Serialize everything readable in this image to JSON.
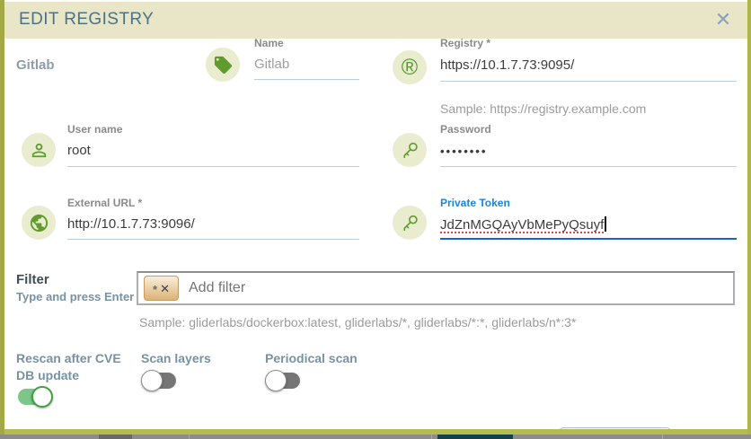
{
  "dialog": {
    "title": "EDIT REGISTRY",
    "close_icon": "✕",
    "registry_display_name": "Gitlab",
    "fields": {
      "name": {
        "label": "Name",
        "placeholder": "Gitlab",
        "value": ""
      },
      "registry": {
        "label": "Registry *",
        "value": "https://10.1.7.73:9095/",
        "hint": "Sample: https://registry.example.com"
      },
      "username": {
        "label": "User name",
        "value": "root"
      },
      "password": {
        "label": "Password",
        "value": "••••••••"
      },
      "external_url": {
        "label": "External URL *",
        "value": "http://10.1.7.73:9096/"
      },
      "private_token": {
        "label": "Private Token",
        "value": "JdZnMGQAyVbMePyQsuyf"
      }
    },
    "icons": {
      "registry_glyph": "®",
      "name": "tag-icon",
      "username": "person-icon",
      "password": "key-icon",
      "external_url": "globe-icon",
      "private_token": "key-icon"
    },
    "filter": {
      "label": "Filter",
      "instruction": "Type and press Enter",
      "chip": {
        "star": "*",
        "close": "✕"
      },
      "placeholder": "Add filter",
      "hint": "Sample: gliderlabs/dockerbox:latest, gliderlabs/*, gliderlabs/*:*, gliderlabs/n*:3*"
    },
    "toggles": {
      "rescan": {
        "label": "Rescan after CVE DB update",
        "state": "on"
      },
      "scan_layers": {
        "label": "Scan layers",
        "state": "off"
      },
      "periodical": {
        "label": "Periodical scan",
        "state": "off"
      }
    },
    "colors": {
      "frame_olive": "#a8af4a",
      "header_bg": "#e9e6c8",
      "title_text": "#4a7288",
      "icon_green": "#5f9c2d",
      "icon_circle_bg": "#e9ecce",
      "label_gray": "#8a8a8a",
      "link_blue": "#1b86d9",
      "focus_underline": "#1467c0",
      "toggle_on_green": "#7cc788",
      "toggle_off_gray": "#757575"
    }
  }
}
